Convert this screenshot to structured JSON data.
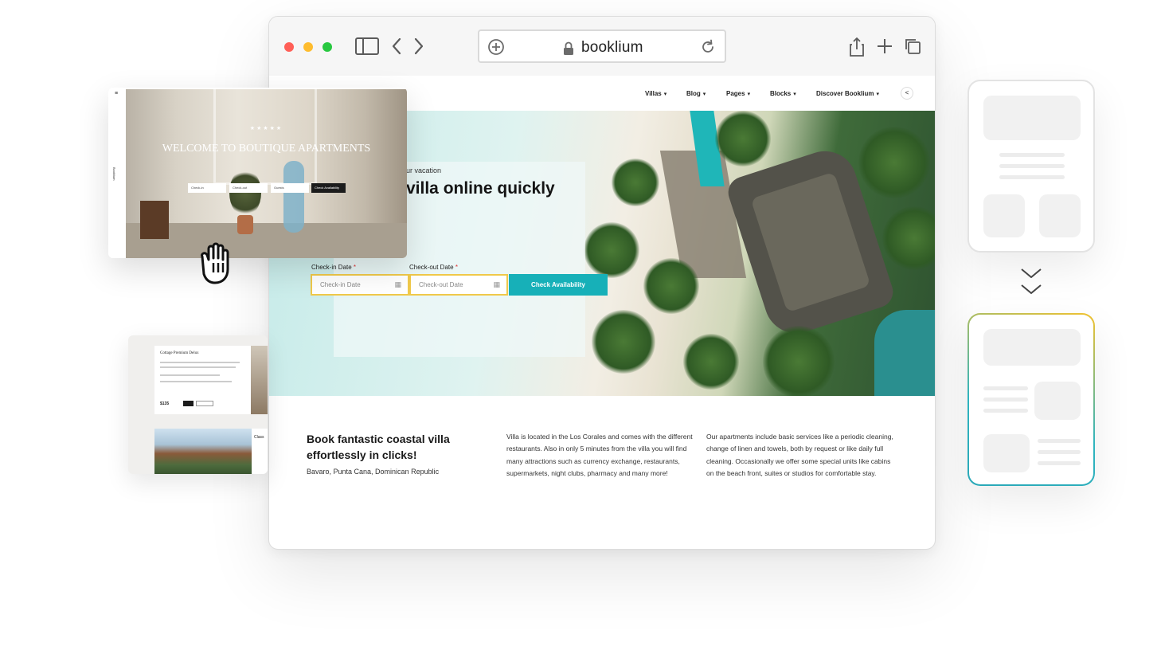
{
  "browser": {
    "url": "booklium",
    "traffic_lights": {
      "red": "#ff5f57",
      "yellow": "#febc2e",
      "green": "#28c840"
    },
    "icons": [
      "sidebar-icon",
      "back-icon",
      "forward-icon",
      "new-tab-plus-icon",
      "lock-icon",
      "reload-icon",
      "share-icon",
      "add-tab-icon",
      "tabs-overview-icon"
    ]
  },
  "site": {
    "nav": [
      {
        "label": "Villas"
      },
      {
        "label": "Blog"
      },
      {
        "label": "Pages"
      },
      {
        "label": "Blocks"
      },
      {
        "label": "Discover Booklium"
      }
    ],
    "hero": {
      "subtitle": "ur vacation",
      "title": "villa online quickly",
      "checkin_label": "Check-in Date",
      "checkout_label": "Check-out Date",
      "required_mark": "*",
      "checkin_placeholder": "Check-in Date",
      "checkout_placeholder": "Check-out Date",
      "button": "Check Availability",
      "accent_color": "#17b0b8",
      "field_border_color": "#f0c94a"
    },
    "info": {
      "title": "Book fantastic coastal villa effortlessly in clicks!",
      "location": "Bavaro, Punta Cana, Dominican Republic",
      "col1": "Villa is located in the Los Corales and comes with the different restaurants. Also in only 5 minutes from the villa you will find many attractions such as currency exchange, restaurants, supermarkets, night clubs, pharmacy and many more!",
      "col2": "Our apartments include basic services like a periodic cleaning, change of linen and towels, both by request or like daily full cleaning. Occasionally we offer some special units like cabins on the beach front, suites or studios for comfortable stay."
    }
  },
  "boutique_card": {
    "stars": "★★★★★",
    "title": "WELCOME TO BOUTIQUE APARTMENTS",
    "checkin": "Check-in",
    "checkout": "Check-out",
    "guests": "Guests",
    "button": "Check Availability",
    "brand": "Booklium"
  },
  "cottage_card": {
    "name": "Cottage Premium Delux",
    "price": "$135",
    "name2": "Class"
  },
  "decor": {
    "gradient_start": "#f2c230",
    "gradient_end": "#2fb4bf"
  }
}
